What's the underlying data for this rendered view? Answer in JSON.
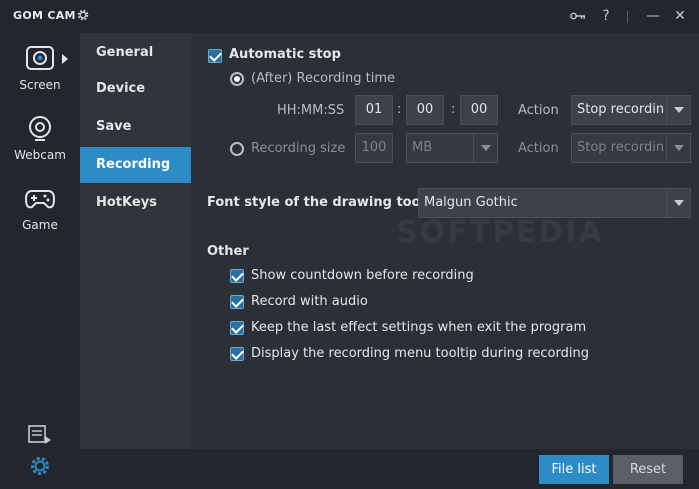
{
  "titlebar": {
    "app_title": "GOM CAM",
    "icons": [
      "settings-gear-icon",
      "key-icon",
      "help-icon",
      "minimize-icon",
      "close-icon"
    ],
    "help_glyph": "?",
    "minimize_glyph": "—",
    "close_glyph": "✕"
  },
  "modes": [
    {
      "label": "Screen",
      "icon": "screen-capture-icon"
    },
    {
      "label": "Webcam",
      "icon": "webcam-icon"
    },
    {
      "label": "Game",
      "icon": "gamepad-icon"
    }
  ],
  "sidebar_bottom_icons": [
    "video-list-icon",
    "settings-gear-icon"
  ],
  "menu": {
    "items": [
      "General",
      "Device",
      "Save",
      "Recording",
      "HotKeys"
    ],
    "active": "Recording"
  },
  "recording": {
    "automatic_stop": {
      "label": "Automatic stop",
      "checked": true
    },
    "after_time": {
      "label": "(After) Recording time",
      "selected": true,
      "format_label": "HH:MM:SS",
      "hh": "01",
      "mm": "00",
      "ss": "00",
      "action_label": "Action",
      "action_value": "Stop recordin"
    },
    "size": {
      "label": "Recording size",
      "selected": false,
      "value": "100",
      "unit": "MB",
      "action_label": "Action",
      "action_value": "Stop recordin"
    },
    "font_style": {
      "label": "Font style of the drawing tools",
      "value": "Malgun Gothic"
    },
    "other": {
      "heading": "Other",
      "options": [
        {
          "label": "Show countdown before recording",
          "checked": true
        },
        {
          "label": "Record with audio",
          "checked": true
        },
        {
          "label": "Keep the last effect settings when exit the program",
          "checked": true
        },
        {
          "label": "Display the recording menu tooltip during recording",
          "checked": true
        }
      ]
    }
  },
  "watermark": "SOFTPEDIA",
  "footer": {
    "file_list_label": "File list",
    "reset_label": "Reset"
  },
  "colors": {
    "accent": "#2d8bc5",
    "background": "#2b2f36",
    "sidebar": "#23262c",
    "menu": "#30343b"
  }
}
